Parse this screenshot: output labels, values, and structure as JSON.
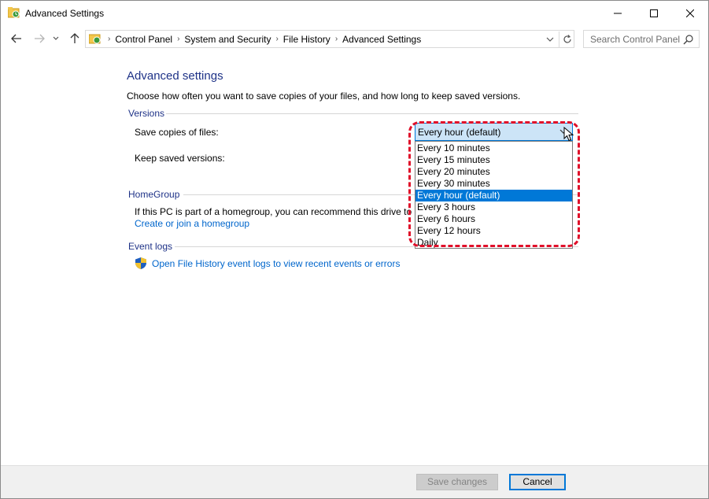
{
  "window": {
    "title": "Advanced Settings",
    "minimize": "—",
    "maximize": "☐",
    "close": "✕"
  },
  "breadcrumb": [
    "Control Panel",
    "System and Security",
    "File History",
    "Advanced Settings"
  ],
  "search": {
    "placeholder": "Search Control Panel"
  },
  "page": {
    "heading": "Advanced settings",
    "intro": "Choose how often you want to save copies of your files, and how long to keep saved versions."
  },
  "versions": {
    "title": "Versions",
    "save_copies_label": "Save copies of files:",
    "keep_versions_label": "Keep saved versions:",
    "selected": "Every hour (default)",
    "options": [
      "Every 10 minutes",
      "Every 15 minutes",
      "Every 20 minutes",
      "Every 30 minutes",
      "Every hour (default)",
      "Every 3 hours",
      "Every 6 hours",
      "Every 12 hours",
      "Daily"
    ]
  },
  "homegroup": {
    "title": "HomeGroup",
    "text": "If this PC is part of a homegroup, you can recommend this drive to",
    "link": "Create or join a homegroup"
  },
  "eventlogs": {
    "title": "Event logs",
    "link": "Open File History event logs to view recent events or errors"
  },
  "footer": {
    "save": "Save changes",
    "cancel": "Cancel"
  },
  "colors": {
    "accent": "#0078d7",
    "heading": "#1e3287",
    "link": "#0066cc",
    "highlight": "#e0102a"
  }
}
